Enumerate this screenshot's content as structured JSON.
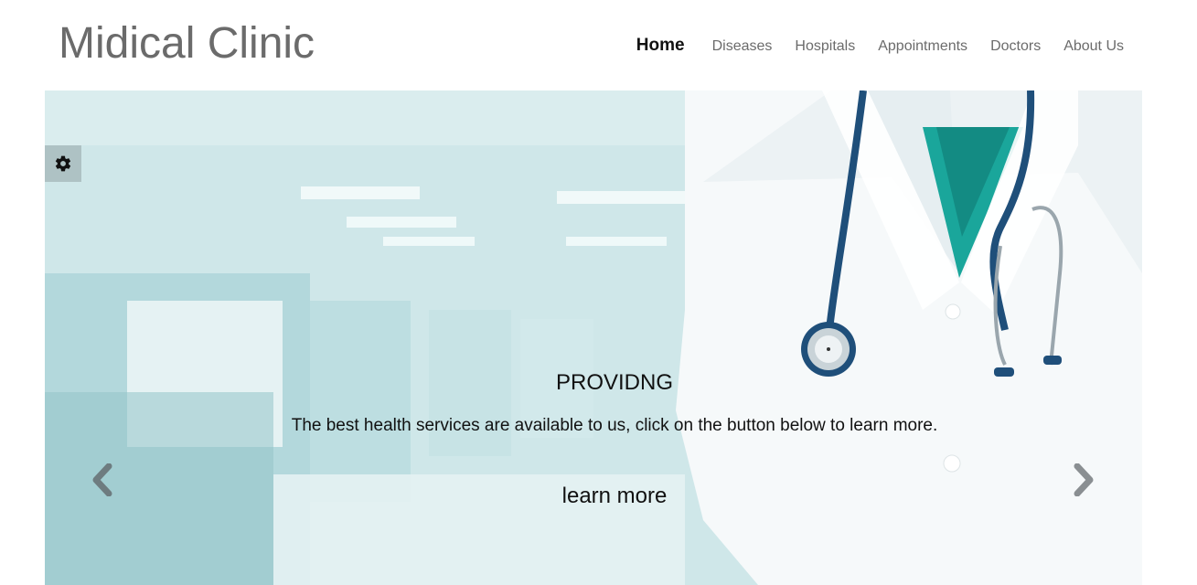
{
  "header": {
    "brand": "Midical Clinic",
    "nav": [
      {
        "label": "Home",
        "active": true
      },
      {
        "label": "Diseases",
        "active": false
      },
      {
        "label": "Hospitals",
        "active": false
      },
      {
        "label": "Appointments",
        "active": false
      },
      {
        "label": "Doctors",
        "active": false
      },
      {
        "label": "About Us",
        "active": false
      }
    ]
  },
  "hero": {
    "title": "PROVIDNG",
    "text": "The best health services are available to us, click on the button below to learn more.",
    "button_label": "learn more",
    "icons": {
      "settings": "gear-icon",
      "prev": "chevron-left-icon",
      "next": "chevron-right-icon"
    }
  },
  "colors": {
    "brand_text": "#6b6b6b",
    "nav_text": "#6b6b6b",
    "nav_active": "#111111",
    "hero_tint": "#b8dde0",
    "coat": "#ffffff",
    "stethoscope": "#1f4f7a",
    "scrubs": "#1aa69b"
  }
}
